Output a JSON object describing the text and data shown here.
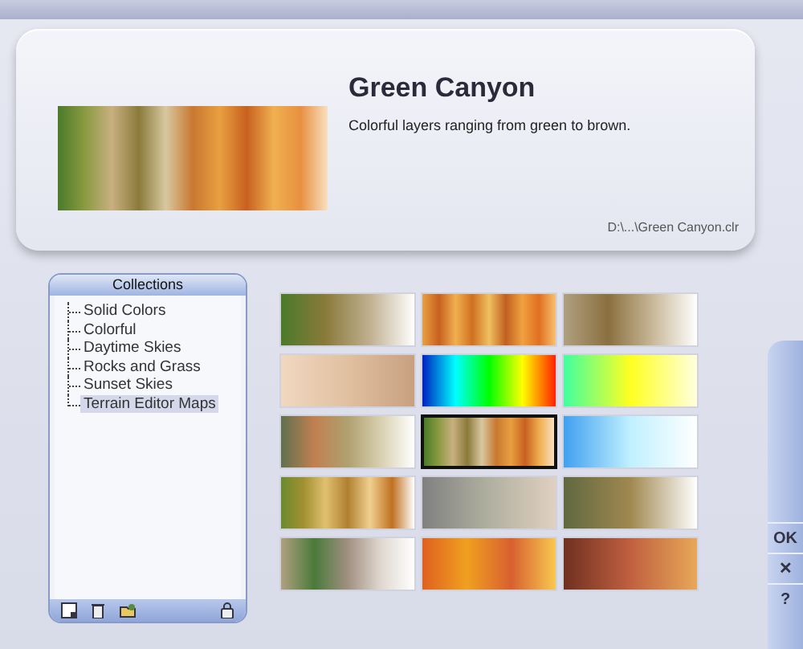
{
  "preview": {
    "name": "Green Canyon",
    "description": "Colorful layers ranging from green to brown.",
    "path": "D:\\...\\Green Canyon.clr"
  },
  "collections": {
    "title": "Collections",
    "items": [
      {
        "label": "Solid Colors",
        "selected": false
      },
      {
        "label": "Colorful",
        "selected": false
      },
      {
        "label": "Daytime Skies",
        "selected": false
      },
      {
        "label": "Rocks and Grass",
        "selected": false
      },
      {
        "label": "Sunset Skies",
        "selected": false
      },
      {
        "label": "Terrain Editor Maps",
        "selected": true
      }
    ]
  },
  "swatches": [
    {
      "selected": false
    },
    {
      "selected": false
    },
    {
      "selected": false
    },
    {
      "selected": false
    },
    {
      "selected": false
    },
    {
      "selected": false
    },
    {
      "selected": false
    },
    {
      "selected": true
    },
    {
      "selected": false
    },
    {
      "selected": false
    },
    {
      "selected": false
    },
    {
      "selected": false
    },
    {
      "selected": false
    },
    {
      "selected": false
    },
    {
      "selected": false
    }
  ],
  "side_buttons": [
    {
      "label": "OK"
    },
    {
      "label": "✕"
    },
    {
      "label": "?"
    }
  ]
}
